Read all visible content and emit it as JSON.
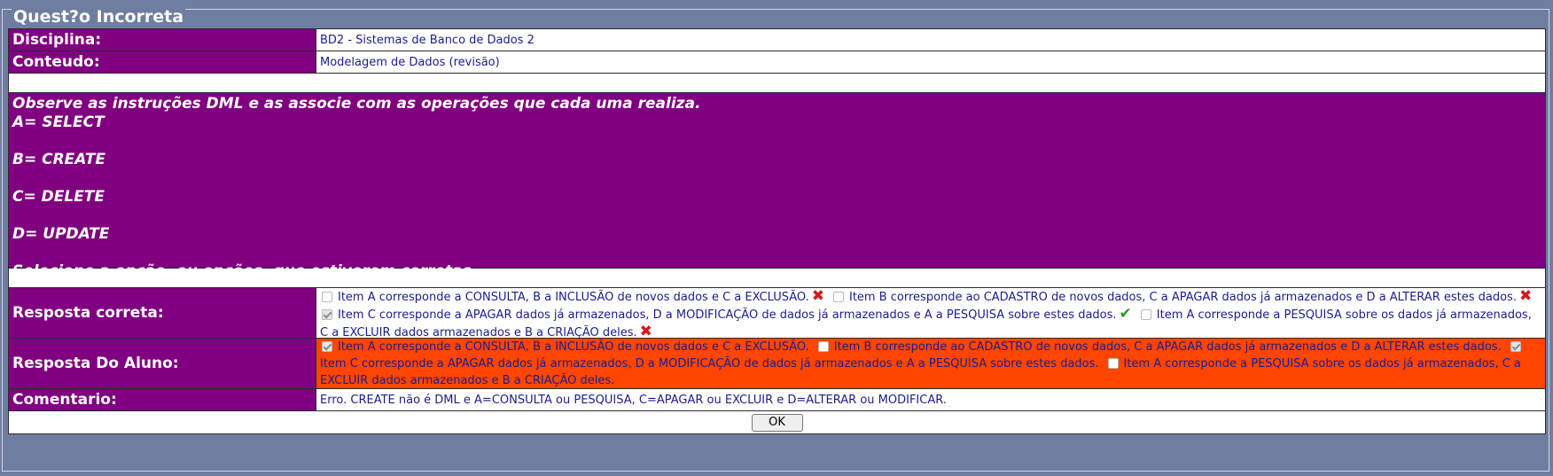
{
  "title": "Quest?o Incorreta",
  "disciplina": {
    "label": "Disciplina:",
    "value": "BD2 - Sistemas de Banco de Dados 2"
  },
  "conteudo": {
    "label": "Conteudo:",
    "value": "Modelagem de Dados (revisão)"
  },
  "question": {
    "lines": [
      "Observe as instruções DML e as associe com as operações que cada uma realiza.",
      "A= SELECT",
      "",
      "B= CREATE",
      "",
      "C= DELETE",
      "",
      "D= UPDATE",
      "",
      "Selecione a opção, ou opções, que estiverem corretas."
    ]
  },
  "resposta_correta": {
    "label": "Resposta correta:",
    "options": [
      {
        "text": "Item A corresponde a CONSULTA, B a INCLUSÃO de novos dados e C a EXCLUSÃO.",
        "checked": false,
        "mark": "✖"
      },
      {
        "text": "Item B corresponde ao CADASTRO de novos dados, C a APAGAR dados já armazenados e D a ALTERAR estes dados.",
        "checked": false,
        "mark": "✖"
      },
      {
        "text": "Item C corresponde a APAGAR dados já armazenados, D a MODIFICAÇÃO de dados já armazenados e A a PESQUISA sobre estes dados.",
        "checked": true,
        "mark": "✔"
      },
      {
        "text": "Item A corresponde a PESQUISA sobre os dados já armazenados, C a EXCLUIR dados armazenados e B a CRIAÇÃO deles.",
        "checked": false,
        "mark": "✖"
      }
    ]
  },
  "resposta_aluno": {
    "label": "Resposta Do Aluno:",
    "options": [
      {
        "text": "Item A corresponde a CONSULTA, B a INCLUSÃO de novos dados e C a EXCLUSÃO.",
        "checked": true
      },
      {
        "text": "Item B corresponde ao CADASTRO de novos dados, C a APAGAR dados já armazenados e D a ALTERAR estes dados.",
        "checked": false
      },
      {
        "text": "Item C corresponde a APAGAR dados já armazenados, D a MODIFICAÇÃO de dados já armazenados e A a PESQUISA sobre estes dados.",
        "checked": true
      },
      {
        "text": "Item A corresponde a PESQUISA sobre os dados já armazenados, C a EXCLUIR dados armazenados e B a CRIAÇÃO deles.",
        "checked": false
      }
    ]
  },
  "comentario": {
    "label": "Comentario:",
    "value": "Erro. CREATE não é DML e A=CONSULTA ou PESQUISA, C=APAGAR ou EXCLUIR e D=ALTERAR ou MODIFICAR."
  },
  "ok_button": "OK",
  "colors": {
    "background": "#6f7da0",
    "label_bg": "#800080",
    "student_bg": "#ff4500",
    "wrong": "#d41a1a",
    "right": "#2b9a1f"
  },
  "icons": {
    "wrong": "x-mark-icon",
    "right": "check-mark-icon"
  }
}
